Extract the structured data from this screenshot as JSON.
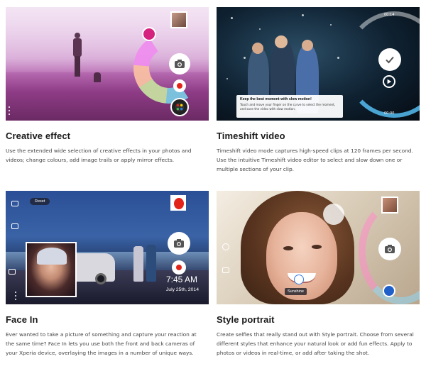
{
  "features": [
    {
      "title": "Creative effect",
      "description": "Use the extended wide selection of creative effects in your photos and videos; change colours, add image trails or apply mirror effects."
    },
    {
      "title": "Timeshift video",
      "description": "Timeshift video mode captures high-speed clips at 120 frames per second. Use the intuitive Timeshift video editor to select and slow down one or multiple sections of your clip.",
      "screen": {
        "tip_title": "Keep the best moment with slow motion!",
        "tip_text": "Touch and move your finger on the curve to select the moment, and save the video with slow motion.",
        "time_start": "00:14",
        "time_end": "00:00"
      }
    },
    {
      "title": "Face In",
      "description": "Ever wanted to take a picture of something and capture your reaction at the same time? Face In lets you use both the front and back cameras of your Xperia device, overlaying the images in a number of unique ways.",
      "screen": {
        "reset_label": "Reset",
        "clock": "7:45 AM",
        "date": "July 25th, 2014"
      }
    },
    {
      "title": "Style portrait",
      "description": "Create selfies that really stand out with Style portrait. Choose from several different styles that enhance your natural look or add fun effects. Apply to photos or videos in real-time, or add after taking the shot.",
      "screen": {
        "style_label": "Sunshine"
      }
    }
  ],
  "icons": {
    "camera": "camera-icon",
    "record": "record-icon",
    "menu": "more-vert-icon",
    "check": "check-icon",
    "play": "play-icon"
  },
  "colors": {
    "record_red": "#e2231a",
    "style_blue": "#1f5fc9"
  }
}
